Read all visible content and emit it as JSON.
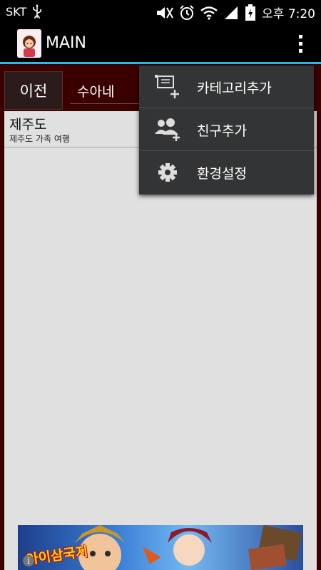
{
  "status_bar": {
    "carrier": "SKT",
    "time": "오후 7:20",
    "icons": [
      "usb-icon",
      "mute-icon",
      "alarm-icon",
      "wifi-icon",
      "signal-icon",
      "battery-icon"
    ]
  },
  "action_bar": {
    "title": "MAIN",
    "accent_color": "#33b5e5",
    "overflow_icon": "more-vert-icon"
  },
  "toolbar": {
    "prev_label": "이전",
    "category_value": "수아네"
  },
  "list": {
    "items": [
      {
        "title": "제주도",
        "subtitle": "제주도 가족 여행"
      }
    ]
  },
  "overflow_menu": {
    "items": [
      {
        "label": "카테고리추가",
        "icon": "add-category-icon"
      },
      {
        "label": "친구추가",
        "icon": "add-friends-icon"
      },
      {
        "label": "환경설정",
        "icon": "settings-icon"
      }
    ]
  },
  "ad_banner": {
    "title": "아이삼국지",
    "info_icon": "info-icon"
  }
}
